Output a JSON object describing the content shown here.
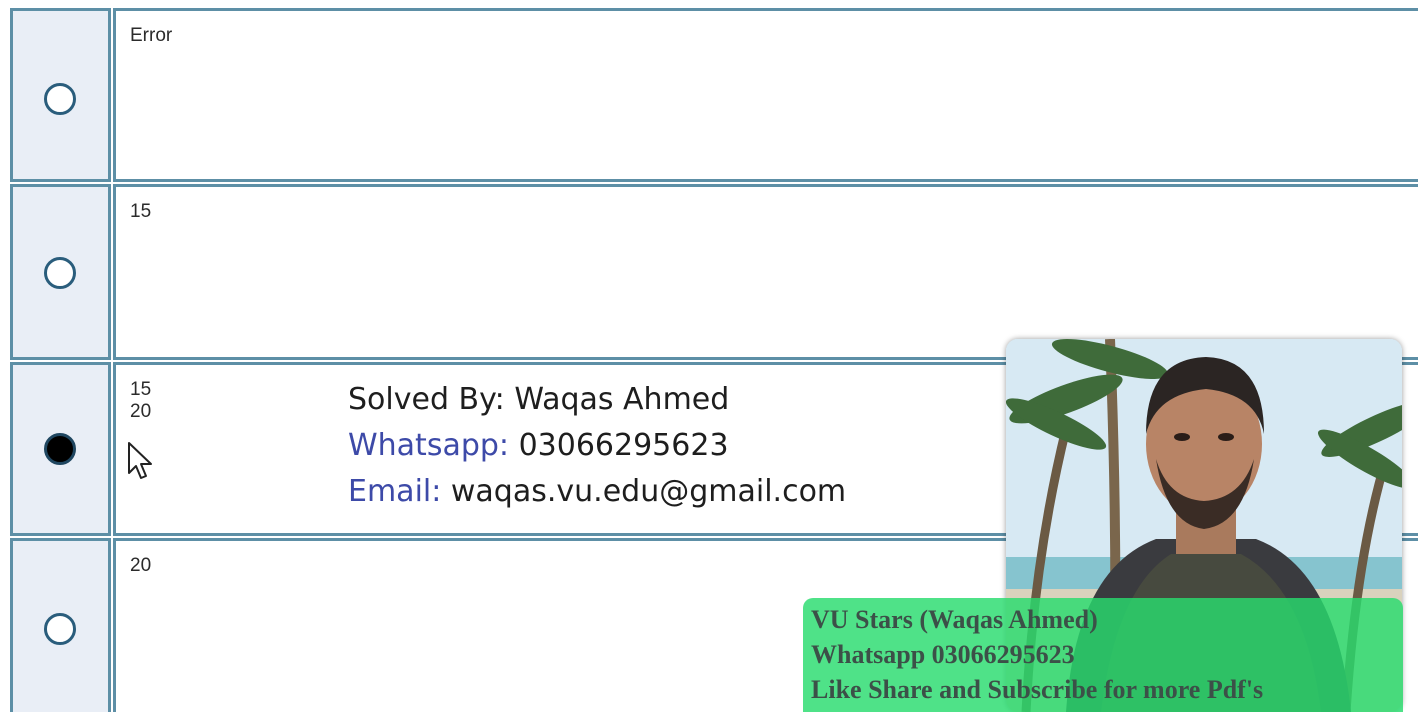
{
  "options": [
    {
      "text": "Error",
      "selected": false
    },
    {
      "text": "15",
      "selected": false
    },
    {
      "text": "15\n20",
      "selected": true
    },
    {
      "text": "20",
      "selected": false
    }
  ],
  "overlay": {
    "solved_by": "Solved By: Waqas Ahmed",
    "whatsapp_label": "Whatsapp:",
    "whatsapp_number": "03066295623",
    "email_label": "Email:",
    "email_value": "waqas.vu.edu@gmail.com"
  },
  "banner": {
    "line1": "VU Stars (Waqas Ahmed)",
    "line2": "Whatsapp 03066295623",
    "line3": "Like Share and Subscribe for more Pdf's"
  },
  "colors": {
    "border": "#5d8fa6",
    "radio_cell_bg": "#e9eef6",
    "label_blue": "#3d4aa8",
    "banner_green": "#28dc6e"
  }
}
